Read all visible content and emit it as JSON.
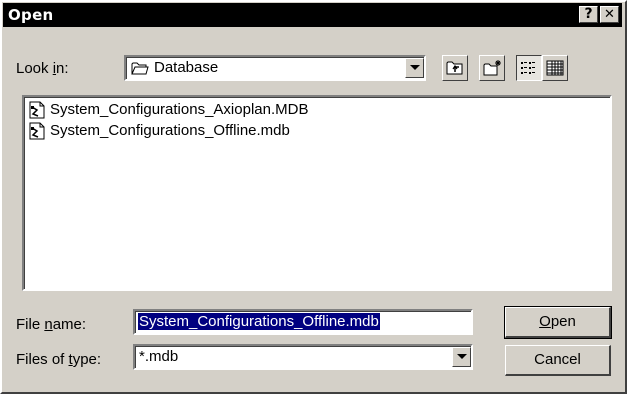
{
  "dialog": {
    "title": "Open",
    "help_label": "?",
    "close_label": "✕"
  },
  "lookin": {
    "label_prefix": "Look ",
    "label_accel": "i",
    "label_suffix": "n:",
    "value": "Database",
    "icon": "folder-icon"
  },
  "toolbar": {
    "up_one_level": "up-folder-icon",
    "new_folder": "new-folder-icon",
    "list_view": "list-view-icon",
    "details_view": "details-view-icon"
  },
  "files": [
    {
      "name": "System_Configurations_Axioplan.MDB",
      "icon": "database-file-icon"
    },
    {
      "name": "System_Configurations_Offline.mdb",
      "icon": "database-file-icon"
    }
  ],
  "filename": {
    "label_prefix": "File ",
    "label_accel": "n",
    "label_suffix": "ame:",
    "value": "System_Configurations_Offline.mdb"
  },
  "filetype": {
    "label_prefix": "Files of ",
    "label_accel": "t",
    "label_suffix": "ype:",
    "value": "*.mdb"
  },
  "buttons": {
    "open_accel": "O",
    "open_rest": "pen",
    "cancel": "Cancel"
  }
}
